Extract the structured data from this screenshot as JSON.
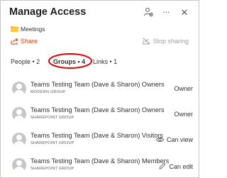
{
  "header": {
    "title": "Manage Access",
    "icons": [
      "manage-people-icon",
      "more-icon",
      "close-icon"
    ],
    "more_glyph": "···",
    "close_glyph": "✕"
  },
  "folder": {
    "name": "Meetings",
    "icon": "folder-icon",
    "color": "#ffb900"
  },
  "actions": {
    "share_label": "Share",
    "share_color": "#d83b01",
    "stop_sharing_label": "Stop sharing"
  },
  "tabs": [
    {
      "label": "People • 2",
      "selected": false
    },
    {
      "label": "Groups • 4",
      "selected": true
    },
    {
      "label": "Links • 1",
      "selected": false
    }
  ],
  "highlight_color": "#e00000",
  "groups": [
    {
      "name": "Teams Testing Team (Dave & Sharon) Owners",
      "type": "MODERN GROUP",
      "permission": "Owner",
      "permission_icon": ""
    },
    {
      "name": "Teams Testing Team (Dave & Sharon) Owners",
      "type": "SHAREPOINT GROUP",
      "permission": "Owner",
      "permission_icon": ""
    },
    {
      "name": "Teams Testing Team (Dave & Sharon) Visitors",
      "type": "SHAREPOINT GROUP",
      "permission": "Can view",
      "permission_icon": "eye-icon"
    },
    {
      "name": "Teams Testing Team (Dave & Sharon) Members",
      "type": "SHAREPOINT GROUP",
      "permission": "Can edit",
      "permission_icon": "pencil-icon"
    }
  ]
}
